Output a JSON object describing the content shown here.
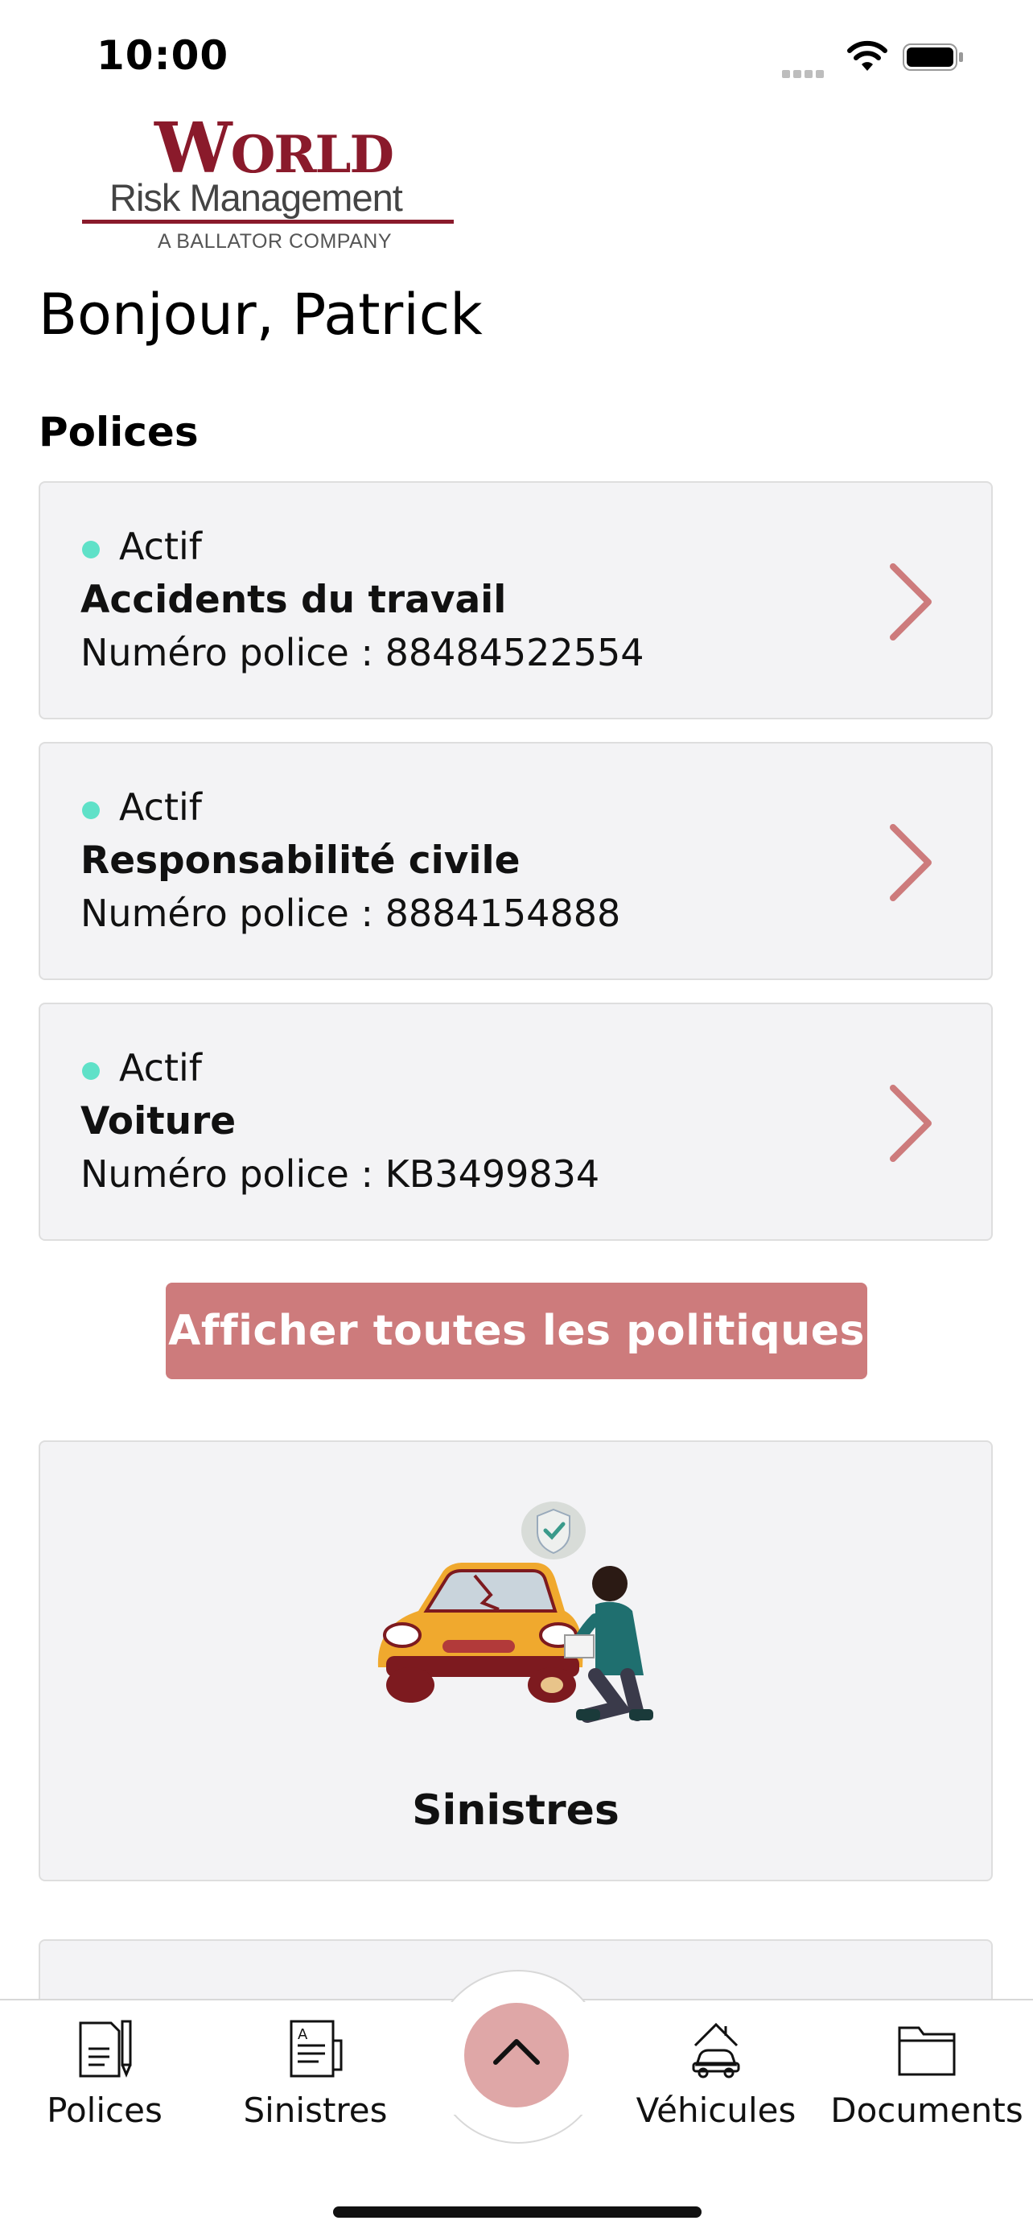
{
  "status_bar": {
    "time": "10:00"
  },
  "logo": {
    "world_first": "W",
    "world_rest": "ORLD",
    "line2": "Risk Management",
    "tagline": "A BALLATOR COMPANY",
    "brand_color": "#8a1a2b"
  },
  "greeting": "Bonjour, Patrick",
  "policies_section": {
    "title": "Polices",
    "items": [
      {
        "status": "Actif",
        "name": "Accidents du travail",
        "number": "Numéro police : 88484522554"
      },
      {
        "status": "Actif",
        "name": "Responsabilité civile",
        "number": "Numéro police : 8884154888"
      },
      {
        "status": "Actif",
        "name": "Voiture",
        "number": "Numéro police : KB3499834"
      }
    ],
    "show_all_label": "Afficher toutes les politiques"
  },
  "claims_card": {
    "label": "Sinistres"
  },
  "tab_bar": {
    "items": [
      {
        "label": "Polices",
        "icon": "document-pen-icon"
      },
      {
        "label": "Sinistres",
        "icon": "claim-form-icon"
      },
      {
        "label": "Véhicules",
        "icon": "car-house-icon"
      },
      {
        "label": "Documents",
        "icon": "folder-icon"
      }
    ],
    "center_icon": "chevron-up-icon"
  },
  "colors": {
    "accent": "#cd7b7c",
    "active_dot": "#5fe1c8",
    "card_bg": "#f3f3f5",
    "center_button": "#dfa7a7"
  }
}
